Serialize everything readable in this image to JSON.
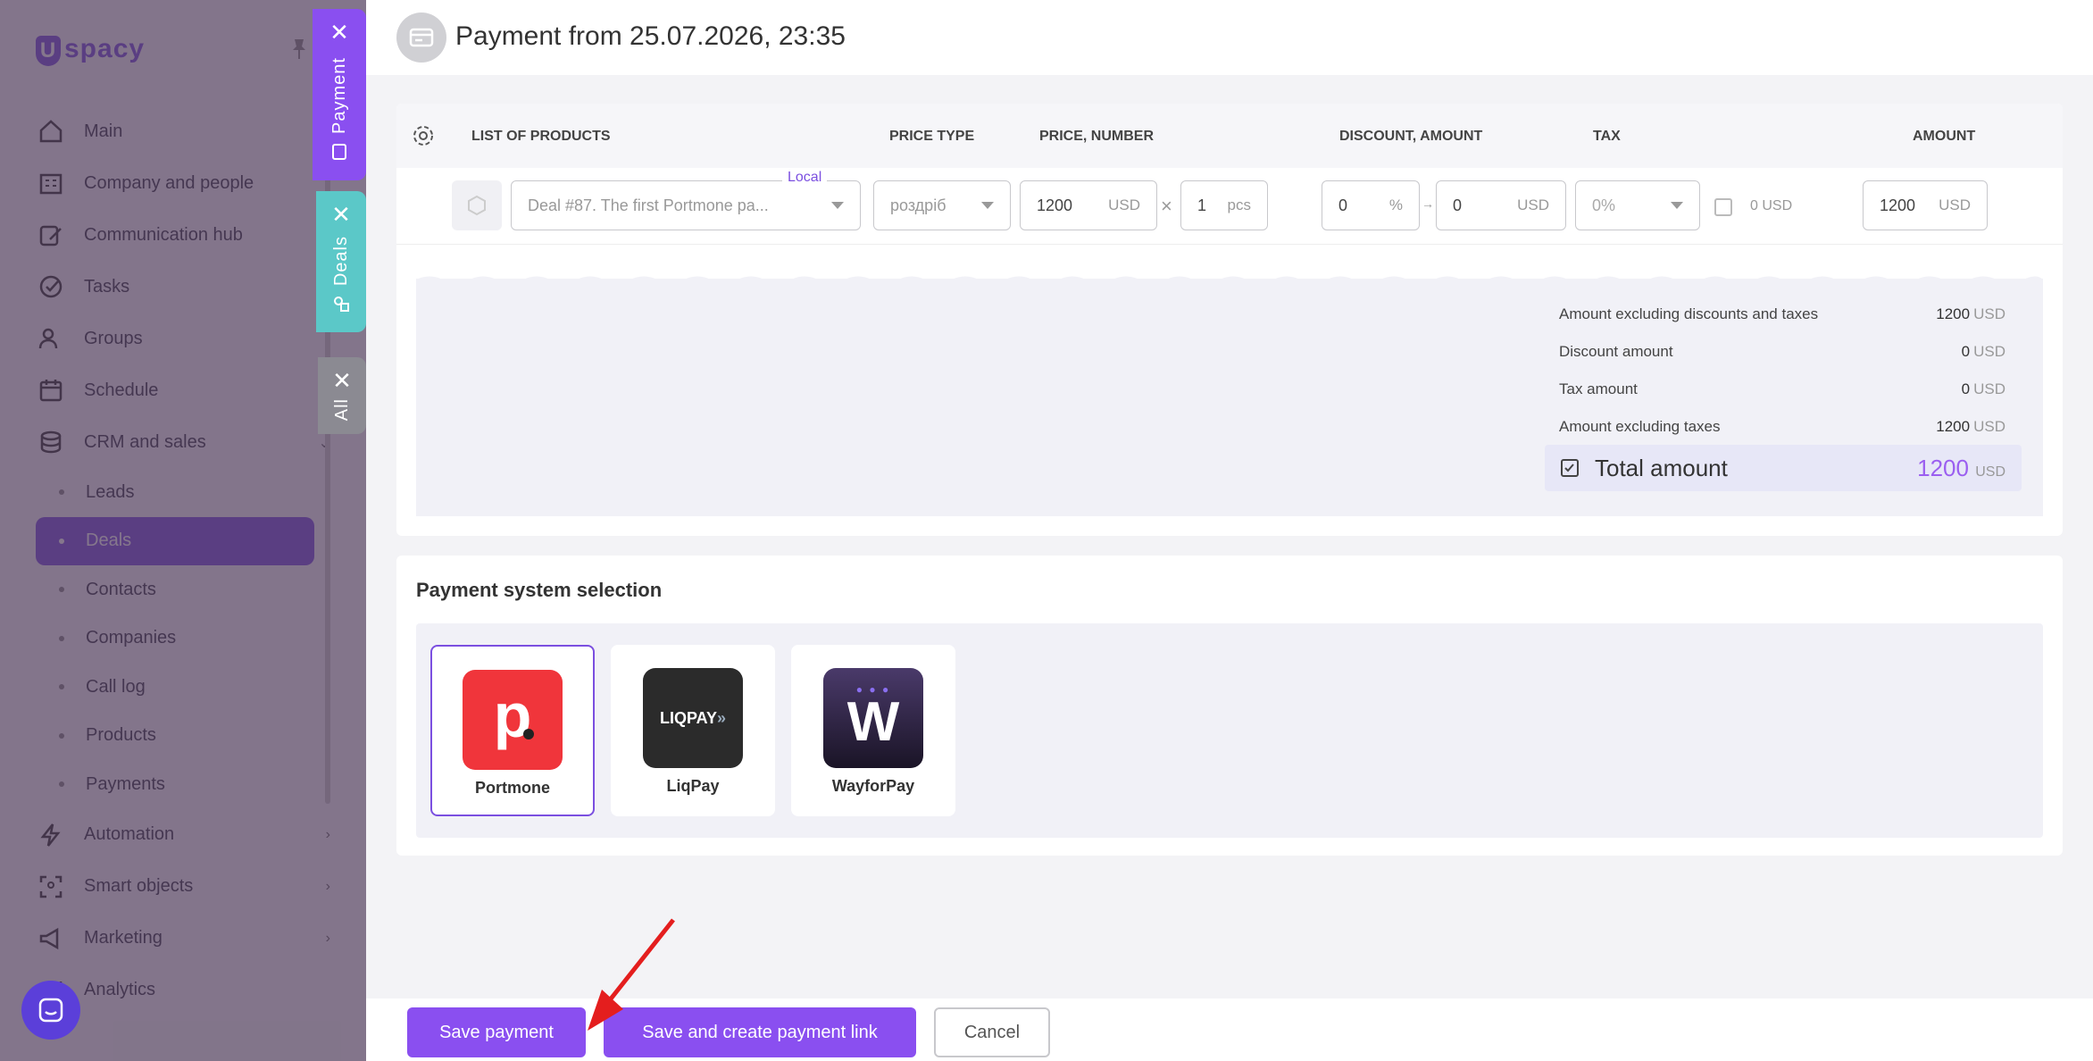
{
  "app": {
    "logo_text": "spacy",
    "logo_letter": "U"
  },
  "sidebar": {
    "items": [
      {
        "label": "Main",
        "icon": "home-icon",
        "chevron": ""
      },
      {
        "label": "Company and people",
        "icon": "building-icon",
        "chevron": "›"
      },
      {
        "label": "Communication hub",
        "icon": "chat-edit-icon",
        "chevron": "›"
      },
      {
        "label": "Tasks",
        "icon": "check-circle-icon",
        "chevron": ""
      },
      {
        "label": "Groups",
        "icon": "users-icon",
        "chevron": ""
      },
      {
        "label": "Schedule",
        "icon": "calendar-icon",
        "chevron": "›"
      },
      {
        "label": "CRM and sales",
        "icon": "database-icon",
        "chevron": "⌄"
      }
    ],
    "crm_sub": [
      "Leads",
      "Deals",
      "Contacts",
      "Companies",
      "Call log",
      "Products",
      "Payments"
    ],
    "active_sub": "Deals",
    "items_after": [
      {
        "label": "Automation",
        "icon": "lightning-icon",
        "chevron": "›"
      },
      {
        "label": "Smart objects",
        "icon": "scan-icon",
        "chevron": "›"
      },
      {
        "label": "Marketing",
        "icon": "megaphone-icon",
        "chevron": "›"
      },
      {
        "label": "Analytics",
        "icon": "chart-icon",
        "chevron": ""
      }
    ]
  },
  "side_tabs": {
    "payment": "Payment",
    "deals": "Deals",
    "all": "All",
    "close": "✕"
  },
  "header": {
    "title": "Payment from 25.07.2026, 23:35"
  },
  "products_table": {
    "columns": [
      "LIST OF PRODUCTS",
      "PRICE TYPE",
      "PRICE, NUMBER",
      "DISCOUNT, AMOUNT",
      "TAX",
      "AMOUNT"
    ],
    "row": {
      "badge": "Local",
      "product": "Deal #87. The first Portmone pa...",
      "price_type": "роздріб",
      "price": "1200",
      "price_unit": "USD",
      "times": "×",
      "qty": "1",
      "qty_unit": "pcs",
      "discount_pct": "0",
      "pct_unit": "%",
      "arrow": "→",
      "discount_amount": "0",
      "discount_unit": "USD",
      "tax": "0%",
      "tax_amount": "0",
      "tax_unit": "USD",
      "amount": "1200",
      "amount_unit": "USD"
    }
  },
  "summary": {
    "rows": [
      {
        "label": "Amount excluding discounts and taxes",
        "value": "1200",
        "unit": "USD"
      },
      {
        "label": "Discount amount",
        "value": "0",
        "unit": "USD"
      },
      {
        "label": "Tax amount",
        "value": "0",
        "unit": "USD"
      },
      {
        "label": "Amount excluding taxes",
        "value": "1200",
        "unit": "USD"
      }
    ],
    "total_label": "Total amount",
    "total_value": "1200",
    "total_unit": "USD"
  },
  "payment_systems": {
    "title": "Payment system selection",
    "items": [
      {
        "name": "Portmone",
        "tile_text": "p",
        "color": "#f0353b"
      },
      {
        "name": "LiqPay",
        "tile_text": "LIQPAY",
        "color": "#2b2b2b"
      },
      {
        "name": "WayforPay",
        "tile_text": "W",
        "color": "#2a1f3d"
      }
    ],
    "selected": "Portmone"
  },
  "footer": {
    "save": "Save payment",
    "save_link": "Save and create payment link",
    "cancel": "Cancel"
  },
  "colors": {
    "accent": "#8a4ff0",
    "payment_tab": "#8a4ff0",
    "deals_tab": "#5bc8c8",
    "all_tab": "#8b8a92"
  }
}
